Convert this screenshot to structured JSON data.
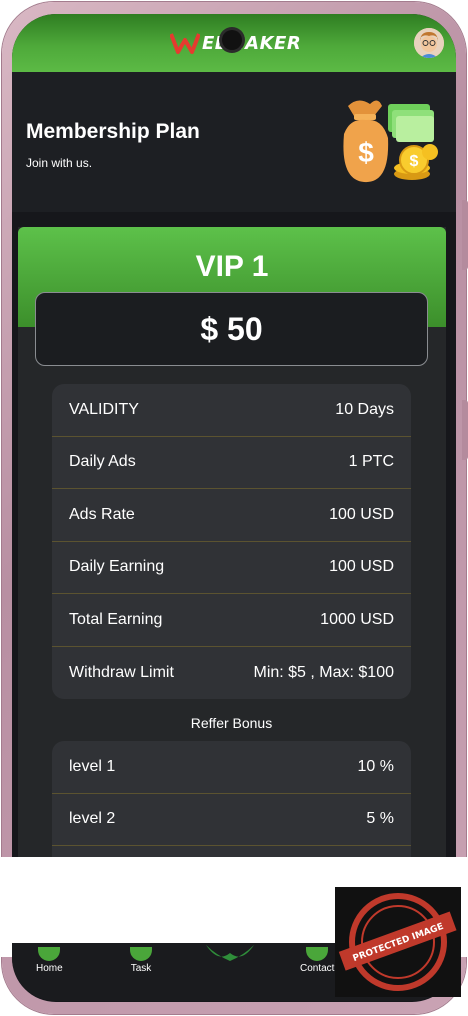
{
  "header": {
    "logo_text": "ELMAKER",
    "avatar_icon": "avatar-icon"
  },
  "hero": {
    "title": "Membership Plan",
    "subtitle": "Join with us.",
    "image_icon": "money-bag-icon"
  },
  "plan": {
    "name": "VIP 1",
    "price": "$ 50",
    "rows": [
      {
        "label": "VALIDITY",
        "value": "10 Days"
      },
      {
        "label": "Daily Ads",
        "value": "1 PTC"
      },
      {
        "label": "Ads Rate",
        "value": "100 USD"
      },
      {
        "label": "Daily Earning",
        "value": "100 USD"
      },
      {
        "label": "Total Earning",
        "value": "1000 USD"
      },
      {
        "label": "Withdraw Limit",
        "value": "Min: $5 , Max: $100"
      }
    ],
    "reffer_title": "Reffer Bonus",
    "reffer_rows": [
      {
        "label": "level 1",
        "value": "10 %"
      },
      {
        "label": "level 2",
        "value": "5 %"
      }
    ]
  },
  "nav": {
    "items": [
      {
        "label": "Home",
        "icon": "home-icon"
      },
      {
        "label": "Task",
        "icon": "task-icon"
      },
      {
        "label": "",
        "icon": "center-logo-icon"
      },
      {
        "label": "Contact",
        "icon": "contact-icon"
      }
    ]
  },
  "watermark": {
    "text": "PROTECTED IMAGE"
  },
  "colors": {
    "accent_green": "#4ea93a",
    "background": "#16171b",
    "card": "#303236"
  }
}
